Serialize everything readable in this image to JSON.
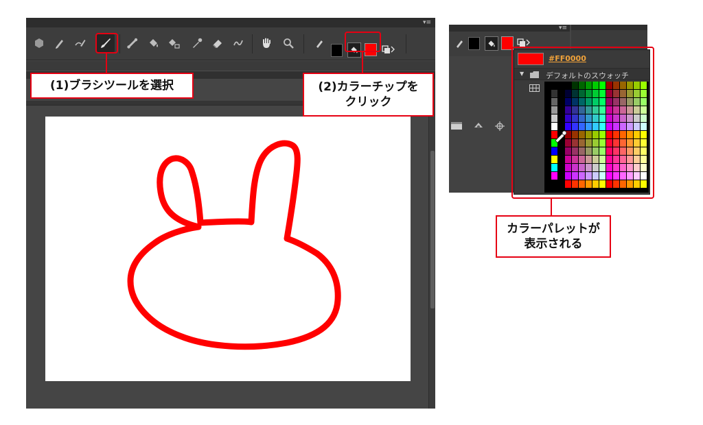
{
  "callouts": {
    "step1": "(1)ブラシツールを選択",
    "step2_line1": "(2)カラーチップを",
    "step2_line2": "クリック",
    "result_line1": "カラーパレットが",
    "result_line2": "表示される"
  },
  "palette": {
    "hex_value": "#FF0000",
    "folder_label": "デフォルトのスウォッチ",
    "current_color": "#ff0000"
  },
  "toolbar": {
    "tools": [
      "shape-tool",
      "pencil-tool",
      "smooth-brush-tool",
      "brush-tool",
      "bone-tool",
      "paint-bucket-tool",
      "fill-bucket-tool",
      "eyedropper-tool",
      "eraser-tool",
      "smudge-tool",
      "hand-tool",
      "zoom-tool"
    ],
    "active_tool": "brush-tool",
    "stroke_color": "#000000",
    "fill_color": "#ff0000"
  },
  "colors": {
    "accent": "#e60012",
    "panel_bg": "#454545",
    "canvas_bg": "#ffffff",
    "drawing_stroke": "#ff0000"
  }
}
